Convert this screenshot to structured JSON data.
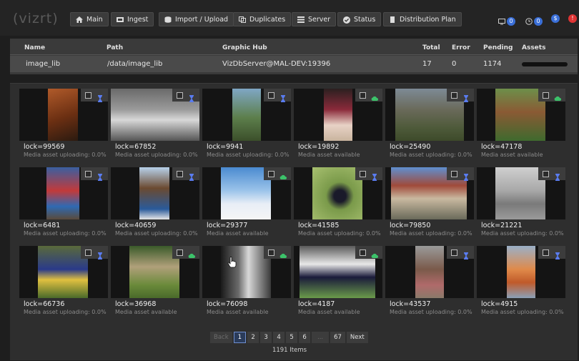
{
  "app": {
    "logo": "vizrt"
  },
  "nav": [
    {
      "key": "main",
      "label": "Main",
      "icon": "home-icon"
    },
    {
      "key": "ingest",
      "label": "Ingest",
      "icon": "ingest-icon"
    },
    {
      "key": "import",
      "label": "Import / Upload",
      "icon": "database-icon"
    },
    {
      "key": "duplicates",
      "label": "Duplicates",
      "icon": "duplicates-icon"
    },
    {
      "key": "server",
      "label": "Server",
      "icon": "server-icon"
    },
    {
      "key": "status",
      "label": "Status",
      "icon": "check-circle-icon"
    },
    {
      "key": "distribution",
      "label": "Distribution Plan",
      "icon": "document-icon"
    }
  ],
  "badges": [
    {
      "icon": "monitor-icon",
      "count": "0",
      "color": "#3a6fd8"
    },
    {
      "icon": "clock-icon",
      "count": "0",
      "color": "#3a6fd8"
    },
    {
      "icon": "dollar-icon",
      "count": "",
      "color": "#3a6fd8"
    },
    {
      "icon": "alert-icon",
      "count": "",
      "color": "#d33"
    }
  ],
  "info": {
    "headers": {
      "name": "Name",
      "path": "Path",
      "hub": "Graphic Hub",
      "total": "Total",
      "error": "Error",
      "pending": "Pending",
      "assets": "Assets"
    },
    "row": {
      "name": "image_lib",
      "path": "/data/image_lib",
      "hub": "VizDbServer@MAL-DEV:19396",
      "total": "17",
      "error": "0",
      "pending": "1174"
    }
  },
  "assets": [
    {
      "label": "lock=99569",
      "status": "Media asset uploading: 0.0%",
      "state": "uploading"
    },
    {
      "label": "lock=67852",
      "status": "Media asset uploading: 0.0%",
      "state": "uploading"
    },
    {
      "label": "lock=9941",
      "status": "Media asset uploading: 0.0%",
      "state": "uploading"
    },
    {
      "label": "lock=19892",
      "status": "Media asset available",
      "state": "available"
    },
    {
      "label": "lock=25490",
      "status": "Media asset uploading: 0.0%",
      "state": "uploading"
    },
    {
      "label": "lock=47178",
      "status": "Media asset available",
      "state": "available"
    },
    {
      "label": "lock=6481",
      "status": "Media asset uploading: 0.0%",
      "state": "uploading"
    },
    {
      "label": "lock=40659",
      "status": "Media asset uploading: 0.0%",
      "state": "uploading"
    },
    {
      "label": "lock=29377",
      "status": "Media asset available",
      "state": "available"
    },
    {
      "label": "lock=41585",
      "status": "Media asset uploading: 0.0%",
      "state": "uploading"
    },
    {
      "label": "lock=79850",
      "status": "Media asset uploading: 0.0%",
      "state": "uploading"
    },
    {
      "label": "lock=21221",
      "status": "Media asset uploading: 0.0%",
      "state": "uploading"
    },
    {
      "label": "lock=66736",
      "status": "Media asset uploading: 0.0%",
      "state": "uploading"
    },
    {
      "label": "lock=36968",
      "status": "Media asset available",
      "state": "available"
    },
    {
      "label": "lock=76098",
      "status": "Media asset available",
      "state": "available"
    },
    {
      "label": "lock=4187",
      "status": "Media asset available",
      "state": "available"
    },
    {
      "label": "lock=43537",
      "status": "Media asset uploading: 0.0%",
      "state": "uploading"
    },
    {
      "label": "lock=4915",
      "status": "Media asset uploading: 0.0%",
      "state": "uploading"
    }
  ],
  "pagination": {
    "back": "Back",
    "pages": [
      "1",
      "2",
      "3",
      "4",
      "5",
      "6"
    ],
    "ellipsis": "...",
    "last": "67",
    "next": "Next",
    "current": "1",
    "items": "1191 Items"
  },
  "colors": {
    "available": "#3cc26a",
    "uploading": "#5a7cf0",
    "accent": "#3a6fd8"
  }
}
